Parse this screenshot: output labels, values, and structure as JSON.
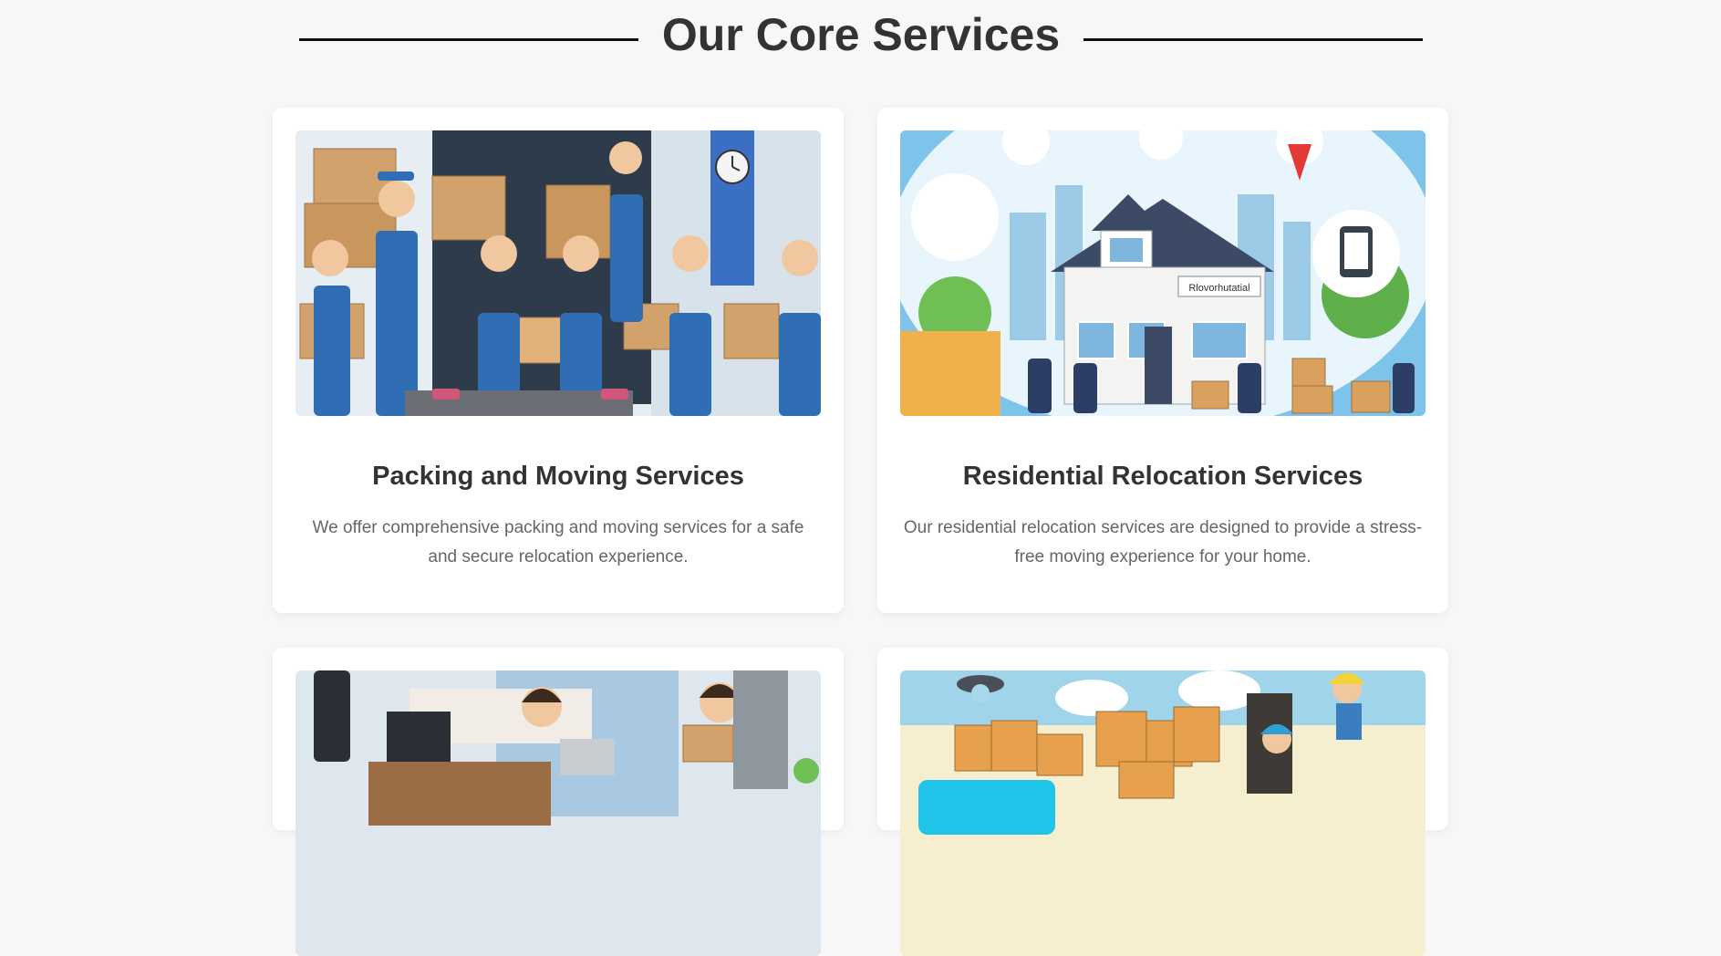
{
  "section": {
    "title": "Our Core Services"
  },
  "services": [
    {
      "title": "Packing and Moving Services",
      "description": "We offer comprehensive packing and moving services for a safe and secure relocation experience.",
      "image_alt": "Movers in blue overalls holding cardboard boxes in front of a truck"
    },
    {
      "title": "Residential Relocation Services",
      "description": "Our residential relocation services are designed to provide a stress-free moving experience for your home.",
      "image_alt": "Illustrated house with movers, boxes and location icons",
      "house_sign": "Rlovorhutatial"
    },
    {
      "title": "",
      "description": "",
      "image_alt": "Office workers packing office furniture and boxes"
    },
    {
      "title": "",
      "description": "",
      "image_alt": "Workers loading boxes with machinery"
    }
  ]
}
